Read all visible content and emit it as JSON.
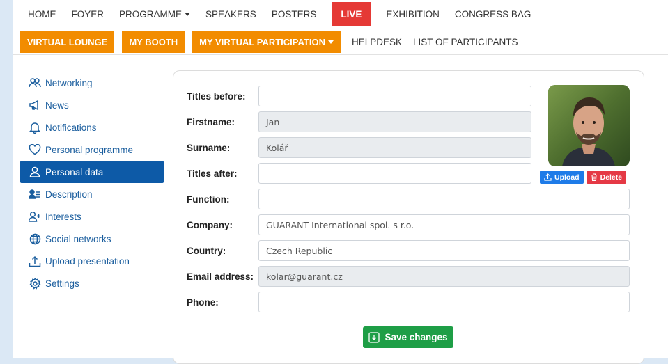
{
  "nav": {
    "primary": [
      "HOME",
      "FOYER",
      "PROGRAMME",
      "SPEAKERS",
      "POSTERS",
      "LIVE",
      "EXHIBITION",
      "CONGRESS BAG"
    ],
    "secondary_buttons": [
      "VIRTUAL LOUNGE",
      "MY BOOTH",
      "MY VIRTUAL PARTICIPATION"
    ],
    "secondary_links": [
      "HELPDESK",
      "LIST OF PARTICIPANTS"
    ]
  },
  "sidebar": {
    "items": [
      {
        "label": "Networking",
        "icon": "people-icon"
      },
      {
        "label": "News",
        "icon": "megaphone-icon"
      },
      {
        "label": "Notifications",
        "icon": "bell-icon"
      },
      {
        "label": "Personal programme",
        "icon": "heart-icon"
      },
      {
        "label": "Personal data",
        "icon": "person-icon",
        "active": true
      },
      {
        "label": "Description",
        "icon": "person-text-icon"
      },
      {
        "label": "Interests",
        "icon": "person-plus-icon"
      },
      {
        "label": "Social networks",
        "icon": "globe-icon"
      },
      {
        "label": "Upload presentation",
        "icon": "upload-icon"
      },
      {
        "label": "Settings",
        "icon": "gear-icon"
      }
    ]
  },
  "form": {
    "titles_before": {
      "label": "Titles before:",
      "value": ""
    },
    "firstname": {
      "label": "Firstname:",
      "value": "Jan"
    },
    "surname": {
      "label": "Surname:",
      "value": "Kolář"
    },
    "titles_after": {
      "label": "Titles after:",
      "value": ""
    },
    "function": {
      "label": "Function:",
      "value": ""
    },
    "company": {
      "label": "Company:",
      "value": "GUARANT International spol. s r.o."
    },
    "country": {
      "label": "Country:",
      "value": "Czech Republic"
    },
    "email": {
      "label": "Email address:",
      "value": "kolar@guarant.cz"
    },
    "phone": {
      "label": "Phone:",
      "value": ""
    },
    "upload_label": "Upload",
    "delete_label": "Delete",
    "save_label": "Save changes"
  },
  "colors": {
    "accent_orange": "#f28c00",
    "live_red": "#e53935",
    "active_blue": "#0d5aa7",
    "save_green": "#1e9e46"
  }
}
